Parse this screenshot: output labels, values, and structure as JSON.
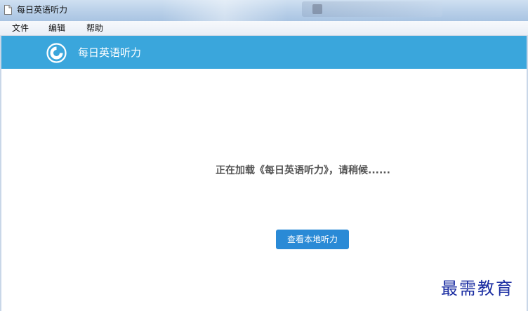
{
  "window": {
    "title": "每日英语听力",
    "icon": "document-icon"
  },
  "menubar": {
    "items": [
      {
        "label": "文件"
      },
      {
        "label": "编辑"
      },
      {
        "label": "帮助"
      }
    ]
  },
  "header": {
    "logo_icon": "app-logo-icon",
    "app_name": "每日英语听力",
    "background_color": "#3aa6dc"
  },
  "content": {
    "loading_text": "正在加载《每日英语听力》，请稍候......",
    "local_button_label": "查看本地听力",
    "button_color": "#2a8ad6"
  },
  "watermark": {
    "text": "最需教育",
    "color": "#1d2fa3"
  }
}
